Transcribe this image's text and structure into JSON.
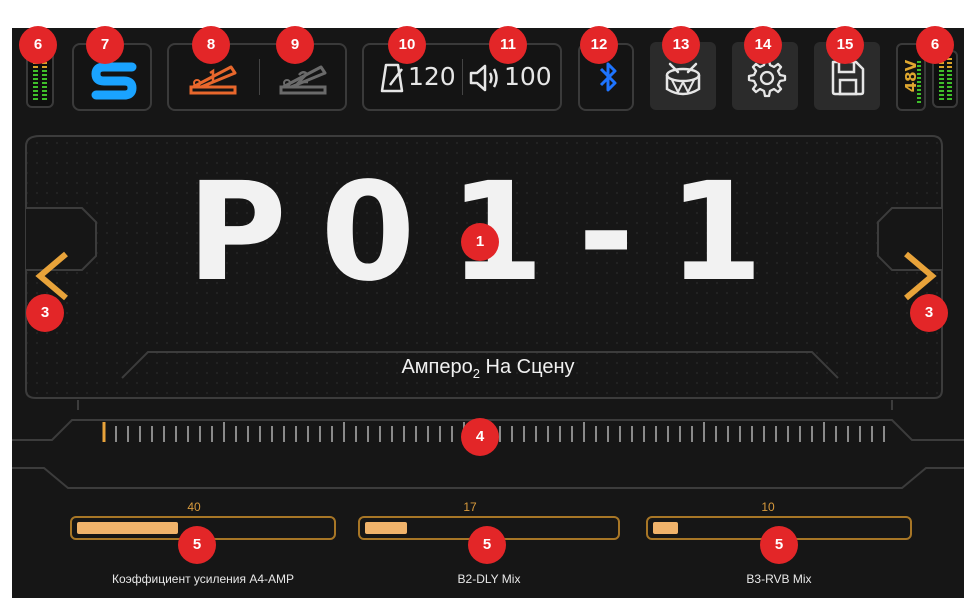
{
  "header": {
    "tempo_value": "120",
    "volume_value": "100",
    "phantom_label": "48V"
  },
  "preset": {
    "name": "P01-1",
    "title_prefix": "Амперо",
    "title_sub": "2",
    "title_suffix": " На Сцену"
  },
  "sliders": [
    {
      "value": "40",
      "label": "Коэффициент усиления A4-AMP",
      "level_fraction": 0.4
    },
    {
      "value": "17",
      "label": "B2-DLY Mix",
      "level_fraction": 0.17
    },
    {
      "value": "10",
      "label": "B3-RVB Mix",
      "level_fraction": 0.1
    }
  ],
  "callouts": [
    "1",
    "3",
    "3",
    "4",
    "5",
    "5",
    "5",
    "6",
    "6",
    "7",
    "8",
    "9",
    "10",
    "11",
    "12",
    "13",
    "14",
    "15"
  ],
  "colors": {
    "background": "#161616",
    "accent_orange": "#e8a33a",
    "callout_red": "#e32628",
    "bluetooth_blue": "#1e74ff",
    "logo_blue": "#1aa3ff",
    "expression_orange": "#e8672c"
  },
  "icons": {
    "logo": "s-logo-icon",
    "expression1": "expression-pedal-1-icon",
    "expression2": "expression-pedal-2-icon",
    "tempo": "metronome-icon",
    "volume": "speaker-icon",
    "bluetooth": "bluetooth-icon",
    "drum": "drum-icon",
    "settings": "gear-icon",
    "save": "floppy-disk-icon"
  }
}
